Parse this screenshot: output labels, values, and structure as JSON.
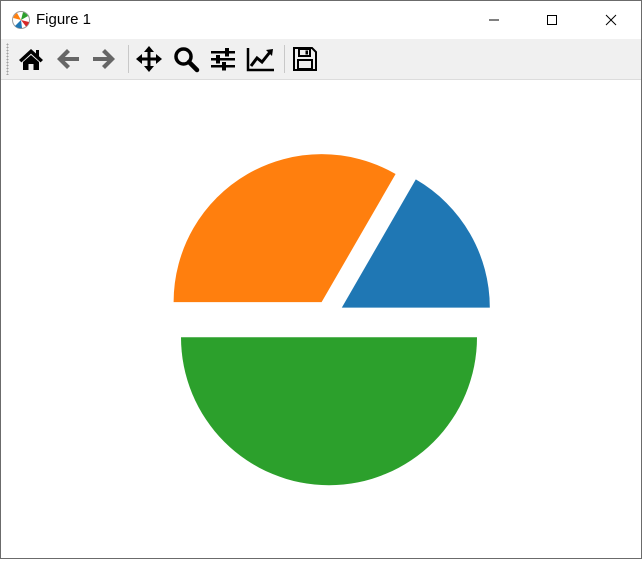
{
  "window": {
    "title": "Figure 1",
    "controls": {
      "minimize_icon": "minimize-icon",
      "maximize_icon": "maximize-icon",
      "close_icon": "close-icon"
    }
  },
  "toolbar": {
    "tools": [
      {
        "name": "home",
        "icon": "home-icon"
      },
      {
        "name": "back",
        "icon": "arrow-left-icon"
      },
      {
        "name": "forward",
        "icon": "arrow-right-icon"
      },
      {
        "name": "pan",
        "icon": "move-icon"
      },
      {
        "name": "zoom",
        "icon": "magnifier-icon"
      },
      {
        "name": "configure-subplots",
        "icon": "sliders-icon"
      },
      {
        "name": "edit-axes",
        "icon": "line-chart-icon"
      },
      {
        "name": "save",
        "icon": "floppy-disk-icon"
      }
    ]
  },
  "chart_data": {
    "type": "pie",
    "title": "",
    "values": [
      1,
      2,
      3
    ],
    "slices": [
      {
        "value": 1,
        "color": "#1f77b4",
        "explode": 0.1
      },
      {
        "value": 2,
        "color": "#ff7f0e",
        "explode": 0.1
      },
      {
        "value": 3,
        "color": "#2ca02c",
        "explode": 0.15
      }
    ],
    "start_angle_deg": 0,
    "direction": "counterclockwise",
    "legend": "none",
    "labels_shown": false
  }
}
